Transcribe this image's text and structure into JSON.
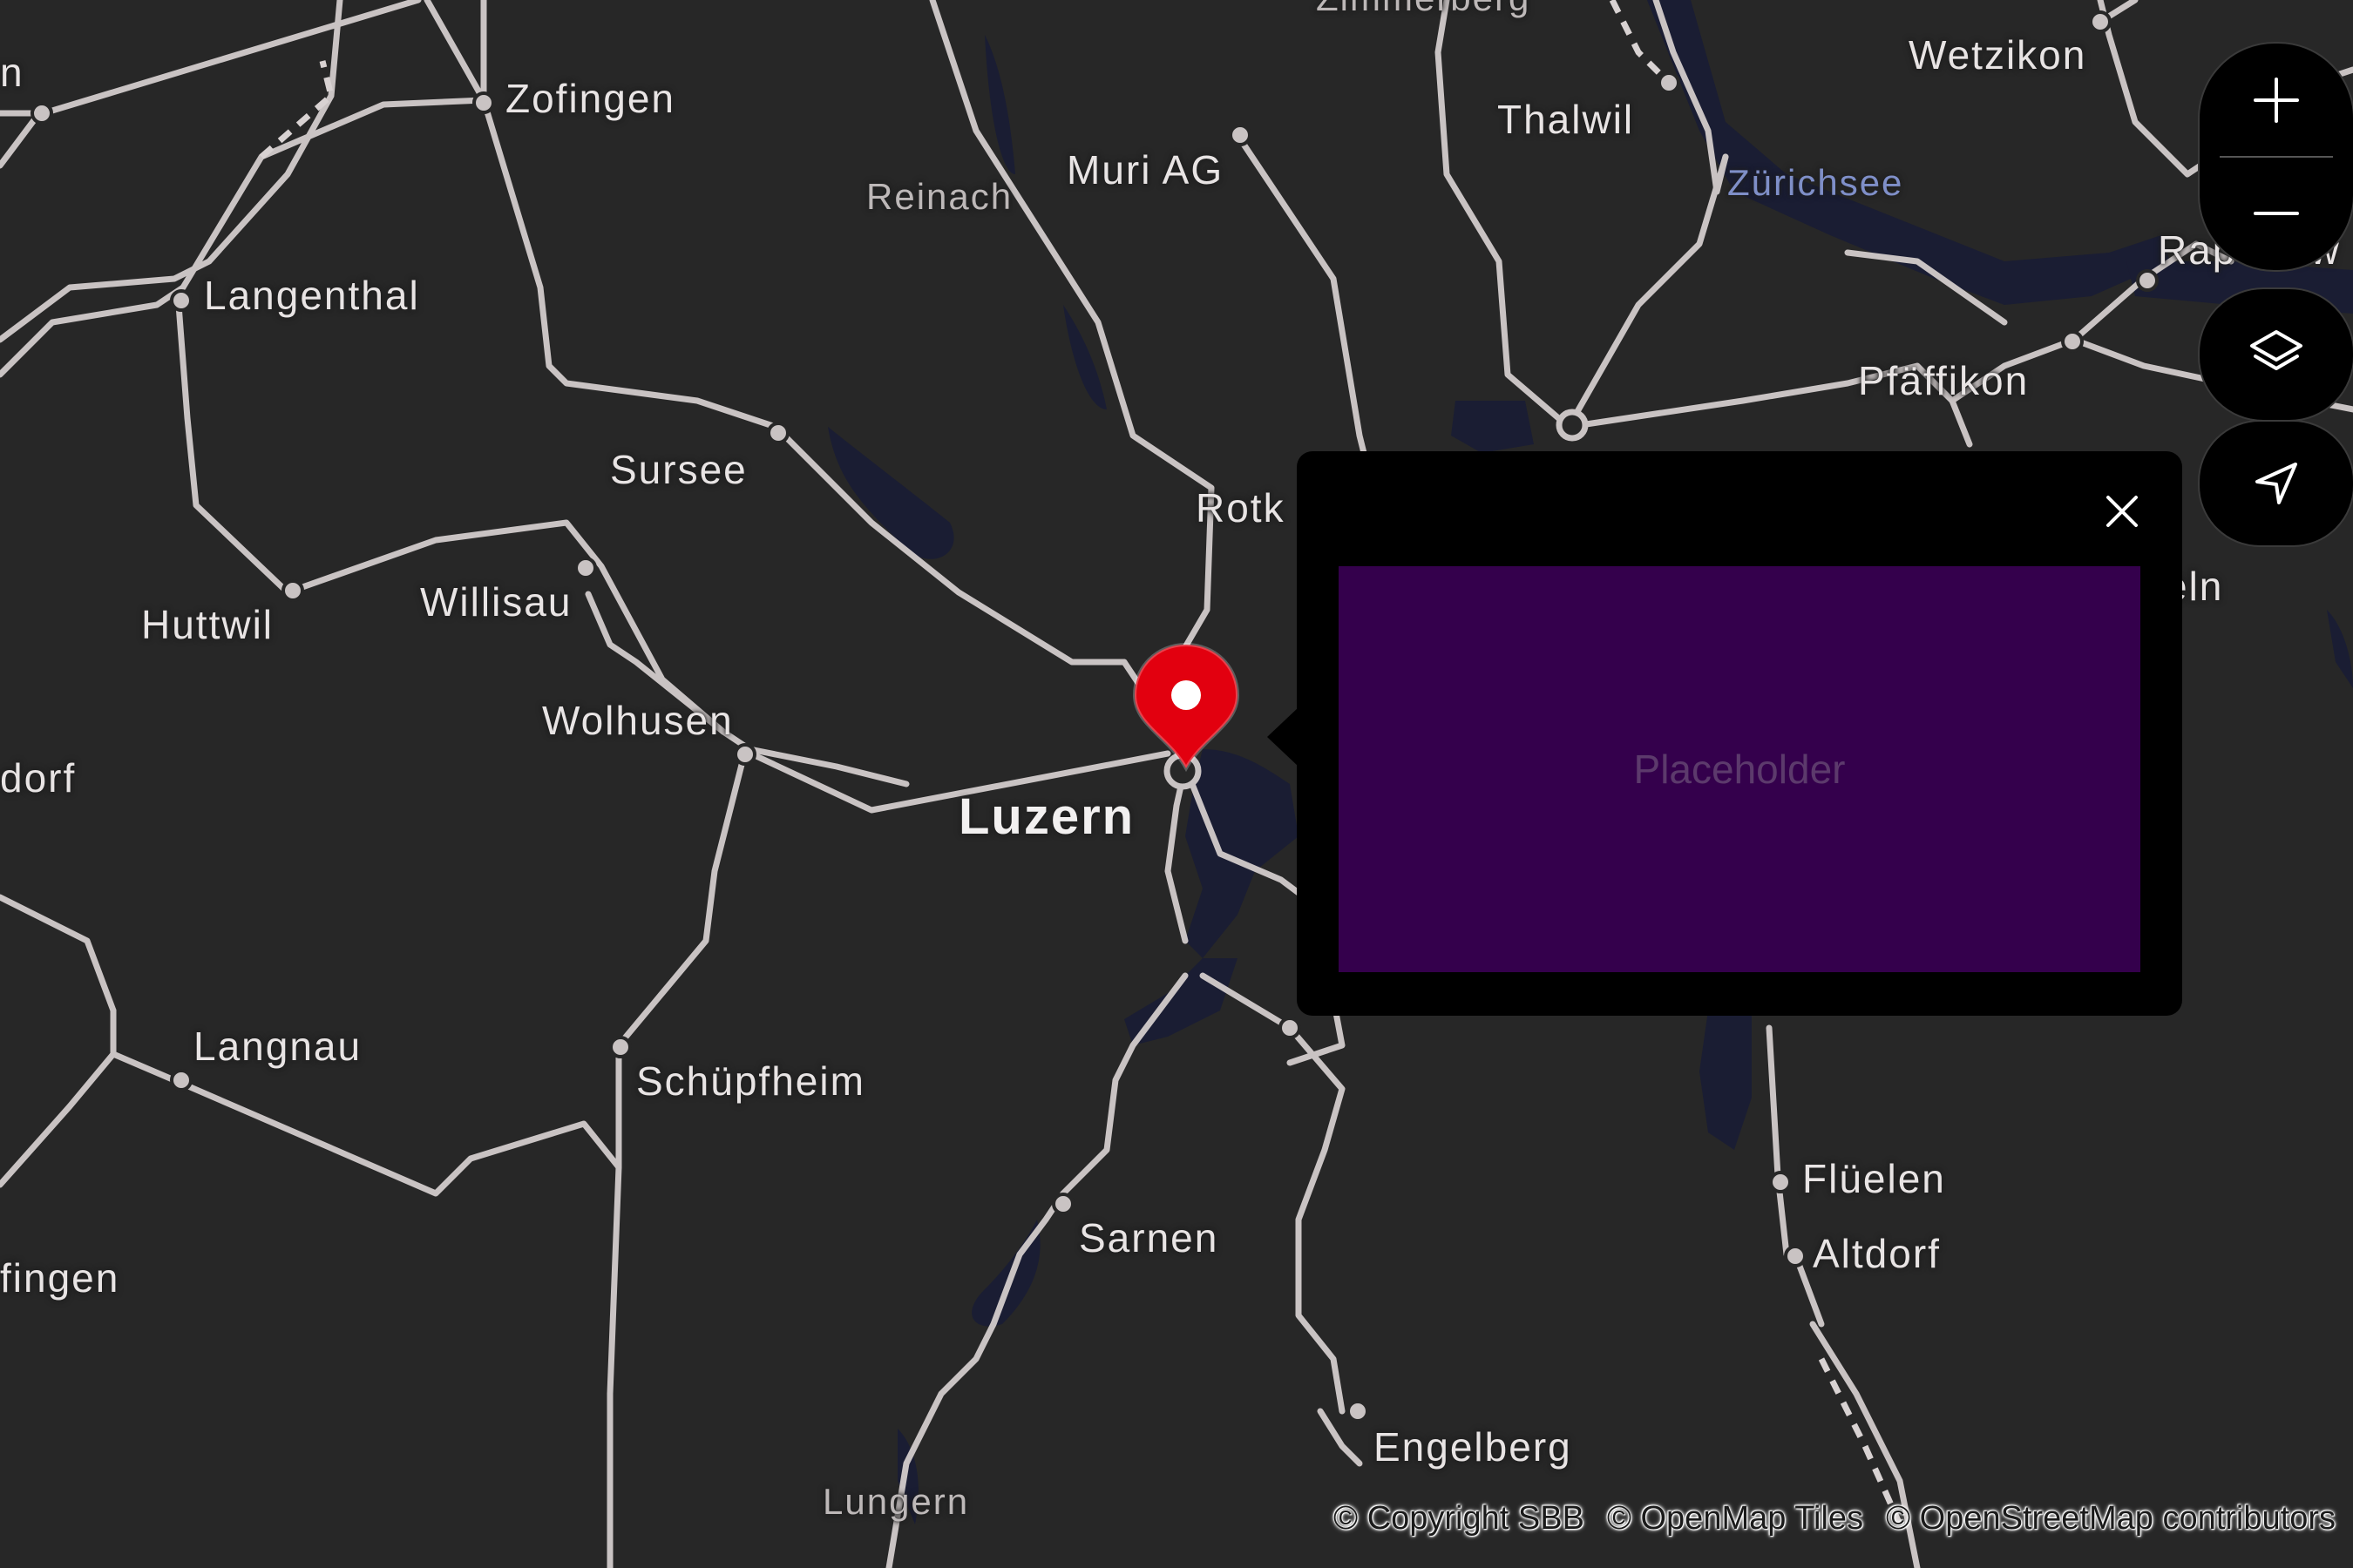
{
  "map": {
    "places": [
      {
        "key": "zofingen",
        "name": "Zofingen"
      },
      {
        "key": "langenthal",
        "name": "Langenthal"
      },
      {
        "key": "reinach",
        "name": "Reinach"
      },
      {
        "key": "muri",
        "name": "Muri AG"
      },
      {
        "key": "thalwil",
        "name": "Thalwil"
      },
      {
        "key": "wetzikon",
        "name": "Wetzikon"
      },
      {
        "key": "zimmerberg",
        "name": "Zimmerberg"
      },
      {
        "key": "zurichsee",
        "name": "Zürichsee"
      },
      {
        "key": "rapperswil",
        "name": "Rap    sw"
      },
      {
        "key": "pfaffikon",
        "name": "Pfäffikon"
      },
      {
        "key": "sursee",
        "name": "Sursee"
      },
      {
        "key": "rotkreuz",
        "name": "Rotk"
      },
      {
        "key": "einsiedeln",
        "name": "eln"
      },
      {
        "key": "huttwil",
        "name": "Huttwil"
      },
      {
        "key": "willisau",
        "name": "Willisau"
      },
      {
        "key": "wolhusen",
        "name": "Wolhusen"
      },
      {
        "key": "burgdorf",
        "name": "dorf"
      },
      {
        "key": "luzern",
        "name": "Luzern"
      },
      {
        "key": "langnau",
        "name": "Langnau"
      },
      {
        "key": "schupfheim",
        "name": "Schüpfheim"
      },
      {
        "key": "fluelen",
        "name": "Flüelen"
      },
      {
        "key": "altdorf",
        "name": "Altdorf"
      },
      {
        "key": "sarnen",
        "name": "Sarnen"
      },
      {
        "key": "konolfingen",
        "name": "fingen"
      },
      {
        "key": "engelberg",
        "name": "Engelberg"
      },
      {
        "key": "lungern",
        "name": "Lungern"
      },
      {
        "key": "olten",
        "name": "n"
      }
    ]
  },
  "controls": {
    "zoom_in": "zoom in",
    "zoom_out": "zoom out",
    "layers": "layers",
    "locate": "my location"
  },
  "popup": {
    "content": "Placeholder"
  },
  "attribution": {
    "items": [
      "© Copyright SBB",
      "© OpenMap Tiles",
      "© OpenStreetMap contributors"
    ]
  },
  "colors": {
    "background": "#272727",
    "water": "#1a1d33",
    "rail": "#c9c3c3",
    "marker": "#e2000f",
    "popup_content": "#34004c"
  }
}
